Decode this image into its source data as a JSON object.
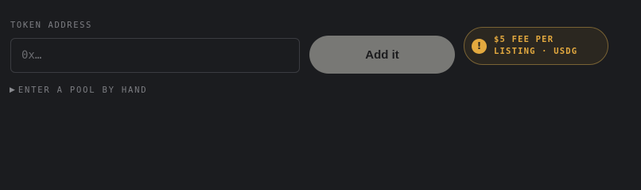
{
  "form": {
    "label": "TOKEN ADDRESS",
    "input_placeholder": "0x…",
    "input_value": "",
    "submit_label": "Add it"
  },
  "fee_notice": {
    "icon": "warning-icon",
    "text": "$5 FEE PER LISTING · USDG",
    "accent_color": "#e3a93f"
  },
  "manual_toggle": {
    "icon": "caret-right-icon",
    "label": "ENTER A POOL BY HAND"
  }
}
